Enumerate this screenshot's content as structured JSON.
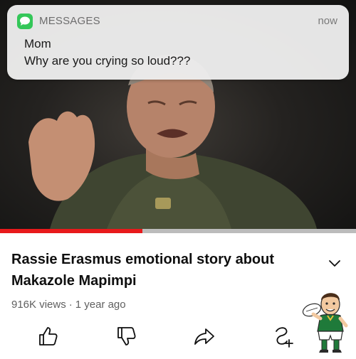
{
  "notification": {
    "app_name": "MESSAGES",
    "time": "now",
    "sender": "Mom",
    "message": "Why are you crying so loud???",
    "app_icon": "messages-bubble-icon",
    "accent_color": "#34c759"
  },
  "video": {
    "progress_fraction": 0.4,
    "progress_color": "#e8191b"
  },
  "video_info": {
    "title": "Rassie Erasmus emotional story about Makazole Mapimpi",
    "views": "916K views",
    "separator": "·",
    "age": "1 year ago",
    "expand_icon": "chevron-down-icon"
  },
  "actions": {
    "like_icon": "thumbs-up-icon",
    "dislike_icon": "thumbs-down-icon",
    "share_icon": "share-icon",
    "remix_icon": "remix-icon"
  }
}
